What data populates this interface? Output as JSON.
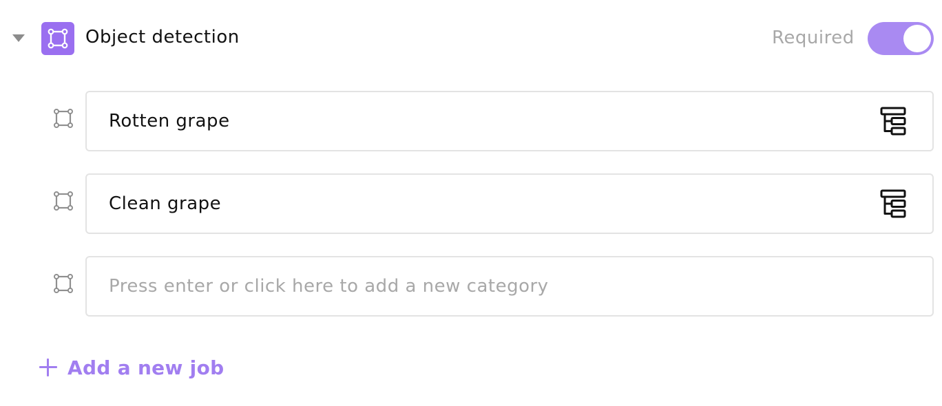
{
  "job": {
    "title": "Object detection",
    "required_label": "Required",
    "required": true,
    "expanded": true,
    "badge_icon": "bounding-box-icon",
    "accent_color": "#9a6ff0",
    "toggle_color": "#a98af2"
  },
  "categories": [
    {
      "name": "Rotten grape",
      "icon": "bounding-box-icon",
      "action_icon": "tree-structure-icon"
    },
    {
      "name": "Clean grape",
      "icon": "bounding-box-icon",
      "action_icon": "tree-structure-icon"
    }
  ],
  "new_category": {
    "placeholder": "Press enter or click here to add a new category",
    "value": ""
  },
  "add_job": {
    "label": "Add a new job",
    "icon": "plus-icon",
    "color": "#a17ef0"
  }
}
